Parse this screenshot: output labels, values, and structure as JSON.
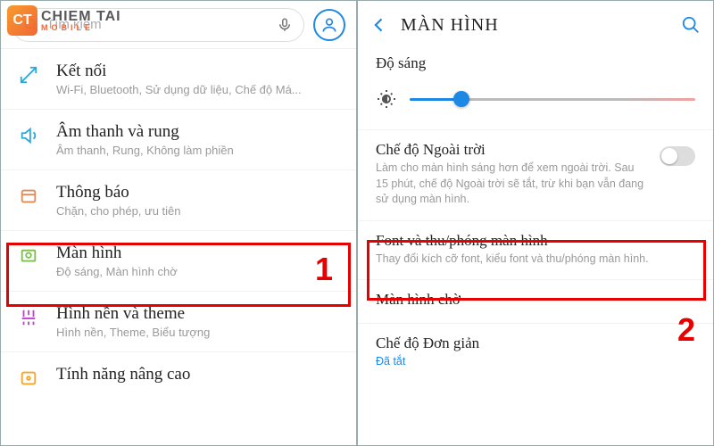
{
  "watermark": {
    "badge": "CT",
    "line1": "CHIEM TAI",
    "line2": "MOBILE"
  },
  "left": {
    "search_placeholder": "Tìm kiếm",
    "rows": [
      {
        "title": "Kết nối",
        "sub": "Wi-Fi, Bluetooth, Sử dụng dữ liệu, Chế độ Má..."
      },
      {
        "title": "Âm thanh và rung",
        "sub": "Âm thanh, Rung, Không làm phiền"
      },
      {
        "title": "Thông báo",
        "sub": "Chặn, cho phép, ưu tiên"
      },
      {
        "title": "Màn hình",
        "sub": "Độ sáng, Màn hình chờ"
      },
      {
        "title": "Hình nền và theme",
        "sub": "Hình nền, Theme, Biểu tượng"
      },
      {
        "title": "Tính năng nâng cao",
        "sub": ""
      }
    ],
    "badge": "1"
  },
  "right": {
    "title": "MÀN HÌNH",
    "brightness_label": "Độ sáng",
    "brightness_pct": 18,
    "outdoor": {
      "title": "Chế độ Ngoài trời",
      "sub": "Làm cho màn hình sáng hơn để xem ngoài trời. Sau 15 phút, chế độ Ngoài trời sẽ tắt, trừ khi bạn vẫn đang sử dụng màn hình."
    },
    "font": {
      "title": "Font và thu/phóng màn hình",
      "sub": "Thay đổi kích cỡ font, kiểu font và thu/phóng màn hình."
    },
    "standby": {
      "title": "Màn hình chờ"
    },
    "simple": {
      "title": "Chế độ Đơn giản",
      "status": "Đã tắt"
    },
    "badge": "2"
  }
}
